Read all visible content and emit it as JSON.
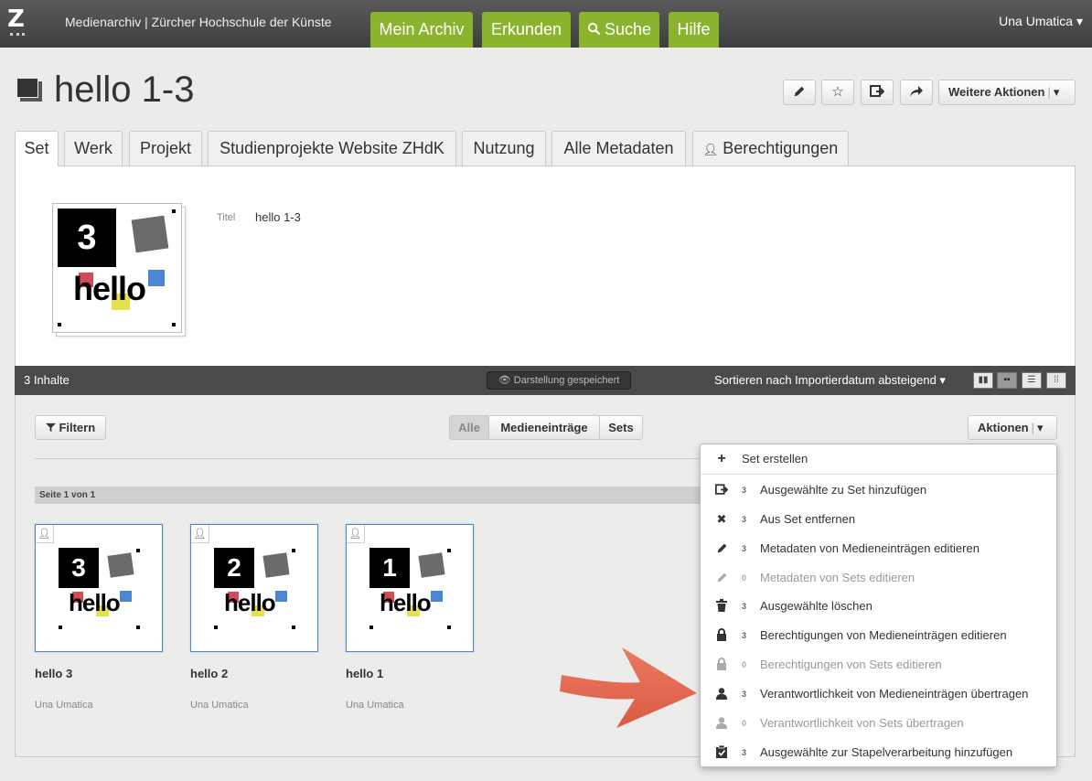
{
  "header": {
    "logo": "Z",
    "site_title": "Medienarchiv | Zürcher Hochschule der Künste",
    "nav": [
      {
        "label": "Mein Archiv"
      },
      {
        "label": "Erkunden"
      },
      {
        "label": "Suche"
      },
      {
        "label": "Hilfe"
      }
    ],
    "user": "Una Umatica ▾"
  },
  "page": {
    "title": "hello 1-3",
    "more_actions": "Weitere Aktionen"
  },
  "tabs": [
    {
      "label": "Set"
    },
    {
      "label": "Werk"
    },
    {
      "label": "Projekt"
    },
    {
      "label": "Studienprojekte Website ZHdK"
    },
    {
      "label": "Nutzung"
    },
    {
      "label": "Alle Metadaten"
    },
    {
      "label": "Berechtigungen"
    }
  ],
  "set_detail": {
    "meta_label": "Titel",
    "meta_value": "hello 1-3",
    "thumb_number": "3",
    "thumb_word": "hello"
  },
  "content_bar": {
    "count": "3 Inhalte",
    "saved": "Darstellung gespeichert",
    "sort": "Sortieren nach Importierdatum absteigend ▾"
  },
  "filters": {
    "filter_label": "Filtern",
    "segments": [
      "Alle",
      "Medieneinträge",
      "Sets"
    ],
    "actions_label": "Aktionen"
  },
  "pagination": "Seite 1 von 1",
  "entries": [
    {
      "number": "3",
      "word": "hello",
      "title": "hello 3",
      "owner": "Una Umatica"
    },
    {
      "number": "2",
      "word": "hello",
      "title": "hello 2",
      "owner": "Una Umatica"
    },
    {
      "number": "1",
      "word": "hello",
      "title": "hello 1",
      "owner": "Una Umatica"
    }
  ],
  "actions_menu": [
    {
      "icon": "plus-icon",
      "count": "",
      "label": "Set erstellen",
      "enabled": true
    },
    {
      "icon": "add-to-set-icon",
      "count": "3",
      "label": "Ausgewählte zu Set hinzufügen",
      "enabled": true
    },
    {
      "icon": "close-icon",
      "count": "3",
      "label": "Aus Set entfernen",
      "enabled": true
    },
    {
      "icon": "pencil-icon",
      "count": "3",
      "label": "Metadaten von Medieneinträgen editieren",
      "enabled": true
    },
    {
      "icon": "pencil-icon",
      "count": "0",
      "label": "Metadaten von Sets editieren",
      "enabled": false
    },
    {
      "icon": "trash-icon",
      "count": "3",
      "label": "Ausgewählte löschen",
      "enabled": true
    },
    {
      "icon": "lock-icon",
      "count": "3",
      "label": "Berechtigungen von Medieneinträgen editieren",
      "enabled": true
    },
    {
      "icon": "lock-icon",
      "count": "0",
      "label": "Berechtigungen von Sets editieren",
      "enabled": false
    },
    {
      "icon": "user-icon",
      "count": "3",
      "label": "Verantwortlichkeit von Medieneinträgen übertragen",
      "enabled": true
    },
    {
      "icon": "user-icon",
      "count": "0",
      "label": "Verantwortlichkeit von Sets übertragen",
      "enabled": false
    },
    {
      "icon": "clipboard-icon",
      "count": "3",
      "label": "Ausgewählte zur Stapelverarbeitung hinzufügen",
      "enabled": true
    }
  ],
  "colors": {
    "nav_green": "#8cb32e",
    "topbar": "#4a4a4a",
    "arrow": "#e0604a",
    "selection_blue": "#4a8ac9"
  }
}
